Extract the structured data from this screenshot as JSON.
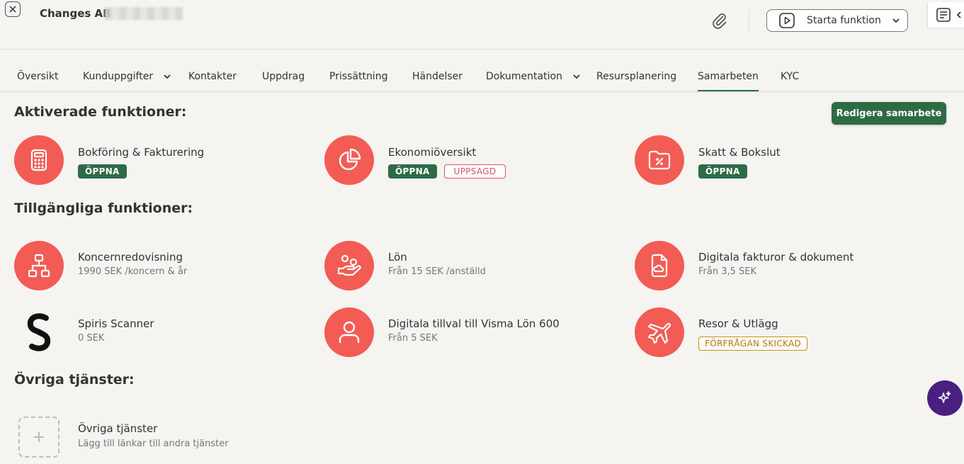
{
  "header": {
    "company": "Changes AB",
    "start_button": "Starta funktion",
    "icons": {
      "close": "close-icon",
      "attach": "paperclip-icon",
      "play": "play-icon",
      "notes": "notes-icon",
      "collapse": "chevron-left-icon"
    }
  },
  "tabs": [
    {
      "label": "Översikt"
    },
    {
      "label": "Kunduppgifter",
      "dropdown": true
    },
    {
      "label": "Kontakter"
    },
    {
      "label": "Uppdrag"
    },
    {
      "label": "Prissättning"
    },
    {
      "label": "Händelser"
    },
    {
      "label": "Dokumentation",
      "dropdown": true
    },
    {
      "label": "Resursplanering"
    },
    {
      "label": "Samarbeten",
      "active": true
    },
    {
      "label": "KYC"
    }
  ],
  "activated": {
    "heading": "Aktiverade funktioner:",
    "edit_button": "Redigera samarbete",
    "items": [
      {
        "title": "Bokföring & Fakturering",
        "icon": "calculator-icon",
        "badges": [
          "ÖPPNA"
        ]
      },
      {
        "title": "Ekonomiöversikt",
        "icon": "pie-chart-icon",
        "badges": [
          "ÖPPNA",
          "UPPSAGD"
        ]
      },
      {
        "title": "Skatt & Bokslut",
        "icon": "tax-folder-icon",
        "badges": [
          "ÖPPNA"
        ]
      }
    ]
  },
  "available": {
    "heading": "Tillgängliga funktioner:",
    "items": [
      {
        "title": "Koncernredovisning",
        "subtitle": "1990 SEK /koncern & år",
        "icon": "org-chart-icon"
      },
      {
        "title": "Lön",
        "subtitle": "Från 15 SEK /anställd",
        "icon": "salary-hand-icon"
      },
      {
        "title": "Digitala fakturor & dokument",
        "subtitle": "Från 3,5 SEK",
        "icon": "cloud-document-icon"
      },
      {
        "title": "Spiris Scanner",
        "subtitle": "0 SEK",
        "icon": "spiris-logo-icon"
      },
      {
        "title": "Digitala tillval till Visma Lön 600",
        "subtitle": "Från 5 SEK",
        "icon": "user-icon"
      },
      {
        "title": "Resor & Utlägg",
        "badge": "FÖRFRÅGAN SKICKAD",
        "icon": "airplane-icon"
      }
    ]
  },
  "other": {
    "heading": "Övriga tjänster:",
    "item": {
      "title": "Övriga tjänster",
      "subtitle": "Lägg till länkar till andra tjänster",
      "icon": "plus-icon"
    }
  },
  "colors": {
    "accent_green": "#2e6b45",
    "icon_red": "#f25c54",
    "badge_red": "#d9546a",
    "badge_gold": "#c89016",
    "ai_purple": "#4a1f7f"
  }
}
